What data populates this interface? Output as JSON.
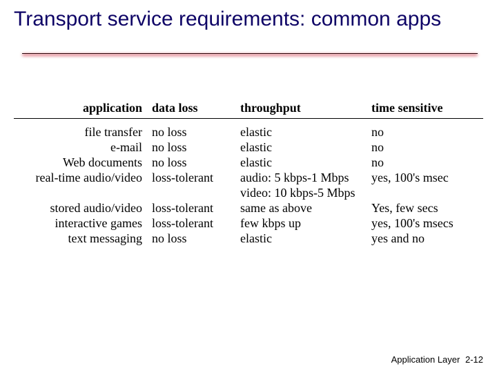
{
  "title": "Transport service requirements: common apps",
  "table": {
    "headers": {
      "application": "application",
      "data_loss": "data loss",
      "throughput": "throughput",
      "time_sensitive": "time sensitive"
    },
    "rows": [
      {
        "application": "file transfer",
        "data_loss": "no loss",
        "throughput": "elastic",
        "time_sensitive": "no"
      },
      {
        "application": "e-mail",
        "data_loss": "no loss",
        "throughput": "elastic",
        "time_sensitive": "no"
      },
      {
        "application": "Web documents",
        "data_loss": "no loss",
        "throughput": "elastic",
        "time_sensitive": "no"
      },
      {
        "application": "real-time audio/video",
        "data_loss": "loss-tolerant",
        "throughput": "audio: 5 kbps-1 Mbps",
        "time_sensitive": "yes, 100's msec"
      },
      {
        "application": "",
        "data_loss": "",
        "throughput": "video: 10 kbps-5 Mbps",
        "time_sensitive": ""
      },
      {
        "application": "stored audio/video",
        "data_loss": "loss-tolerant",
        "throughput": "same as above",
        "time_sensitive": "Yes, few secs"
      },
      {
        "application": "interactive games",
        "data_loss": "loss-tolerant",
        "throughput": "few kbps up",
        "time_sensitive": "yes, 100's msecs"
      },
      {
        "application": "text messaging",
        "data_loss": "no loss",
        "throughput": "elastic",
        "time_sensitive": "yes and no"
      }
    ]
  },
  "footer": {
    "section": "Application Layer",
    "page": "2-12"
  }
}
